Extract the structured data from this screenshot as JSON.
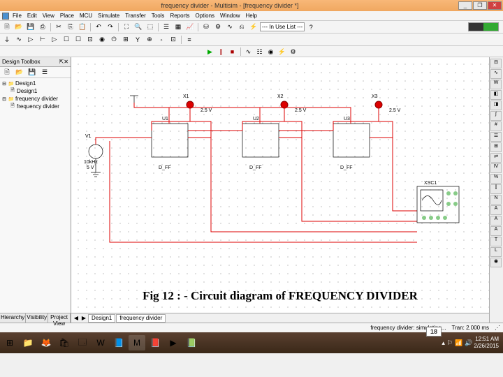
{
  "window": {
    "title": "frequency divider - Multisim - [frequency divider *]",
    "minimize": "_",
    "restore": "❐",
    "close": "✕"
  },
  "menu": {
    "items": [
      "File",
      "Edit",
      "View",
      "Place",
      "MCU",
      "Simulate",
      "Transfer",
      "Tools",
      "Reports",
      "Options",
      "Window",
      "Help"
    ]
  },
  "toolbars": {
    "combo1": "--- In Use List ---",
    "help": "?"
  },
  "sim": {
    "play": "▶",
    "pause": "∥",
    "stop": "■"
  },
  "toolbox": {
    "title": "Design Toolbox",
    "pin": "⇱",
    "close": "✕",
    "tree": [
      {
        "indent": 0,
        "exp": "⊟",
        "icon": "📁",
        "label": "Design1"
      },
      {
        "indent": 1,
        "exp": "",
        "icon": "🗎",
        "label": "Design1"
      },
      {
        "indent": 0,
        "exp": "⊟",
        "icon": "📁",
        "label": "frequency divider"
      },
      {
        "indent": 1,
        "exp": "",
        "icon": "🗎",
        "label": "frequency divider"
      }
    ],
    "tabs": [
      "Hierarchy",
      "Visibility",
      "Project View"
    ]
  },
  "circuit": {
    "probes": {
      "x1": "X1",
      "x2": "X2",
      "x3": "X3"
    },
    "volts": "2.5 V",
    "labels": {
      "u1": "U1",
      "u2": "U2",
      "u3": "U3",
      "v1": "V1"
    },
    "dff": "D_FF",
    "src_freq": "10kHz",
    "src_v": "5 V",
    "scope": "XSC1"
  },
  "caption": "Fig  12 : - Circuit diagram of  FREQUENCY DIVIDER",
  "canvas_tabs": [
    "Design1",
    "frequency divider"
  ],
  "status": {
    "running": "frequency divider: simulating...",
    "tran": "Tran: 2.000 ms"
  },
  "slide_number": "18",
  "tray": {
    "time": "12:51 AM",
    "date": "2/26/2015"
  }
}
